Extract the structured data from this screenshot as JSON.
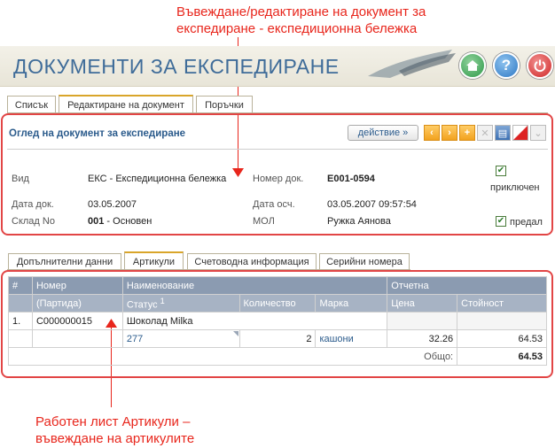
{
  "annotations": {
    "top_line1": "Въвеждане/редактиране на документ за",
    "top_line2": "експедиране - експедиционна бележка",
    "bottom_line1": "Работен лист Артикули –",
    "bottom_line2": "въвеждане на артикулите"
  },
  "header": {
    "title": "ДОКУМЕНТИ ЗА ЕКСПЕДИРАНЕ",
    "home_icon": "home-icon",
    "help_label": "?",
    "power_icon": "power-icon"
  },
  "tabs": [
    "Списък",
    "Редактиране на документ",
    "Поръчки"
  ],
  "form": {
    "title": "Оглед на документ за експедиране",
    "action_label": "действие »",
    "toolbar_icons": [
      "prev-icon",
      "next-icon",
      "add-icon",
      "delete-icon",
      "print-icon",
      "erase-icon",
      "dropdown-icon"
    ],
    "fields": {
      "type_label": "Вид",
      "type_value": "ЕКС - Експедиционна бележка",
      "docnum_label": "Номер док.",
      "docnum_value": "Е001-0594",
      "date_label": "Дата док.",
      "date_value": "03.05.2007",
      "acctdate_label": "Дата осч.",
      "acctdate_value": "03.05.2007 09:57:54",
      "store_label": "Склад No",
      "store_code": "001",
      "store_name": " - Основен",
      "mol_label": "МОЛ",
      "mol_value": "Ружка Аянова"
    },
    "closed_label": "приключен",
    "handed_label": "предал",
    "check_mark": "✔"
  },
  "subtabs": [
    "Допълнителни данни",
    "Артикули",
    "Счетоводна информация",
    "Серийни номера"
  ],
  "grid": {
    "headers": {
      "idx": "#",
      "number": "Номер",
      "name": "Наименование",
      "reporting": "Отчетна",
      "batch": "(Партида)",
      "status": "Статус",
      "status_sup": "1",
      "quantity": "Количество",
      "unit": "Марка",
      "price": "Цена",
      "value": "Стойност"
    },
    "row": {
      "idx": "1.",
      "number": "C000000015",
      "name": "Шоколад Milka",
      "status": "277",
      "quantity": "2",
      "unit": "кашони",
      "price": "32.26",
      "value": "64.53"
    },
    "total_label": "Общо:",
    "total_value": "64.53"
  }
}
